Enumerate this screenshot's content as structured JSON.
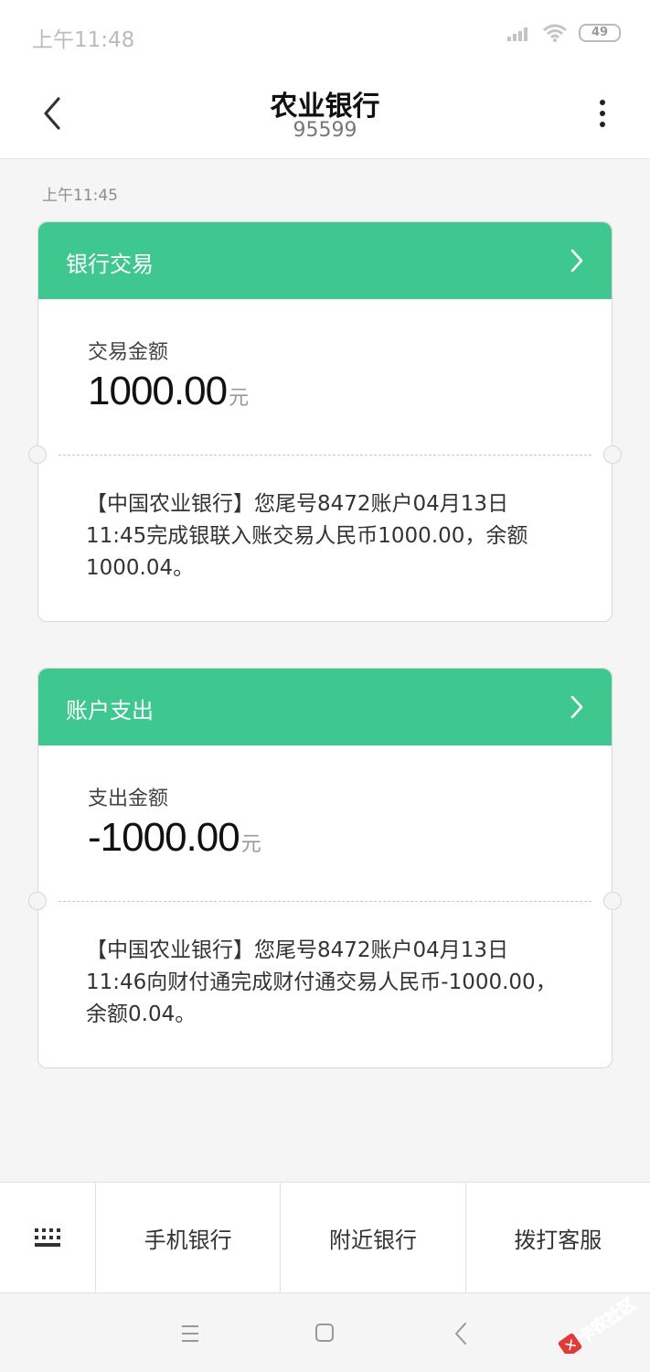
{
  "status_bar": {
    "time": "上午11:48",
    "battery": "49"
  },
  "header": {
    "title": "农业银行",
    "number": "95599"
  },
  "message_time": "上午11:45",
  "cards": [
    {
      "header": "银行交易",
      "amount_label": "交易金额",
      "amount": "1000.00",
      "unit": "元",
      "text": "【中国农业银行】您尾号8472账户04月13日11:45完成银联入账交易人民币1000.00，余额1000.04。"
    },
    {
      "header": "账户支出",
      "amount_label": "支出金额",
      "amount": "-1000.00",
      "unit": "元",
      "text": "【中国农业银行】您尾号8472账户04月13日11:46向财付通完成财付通交易人民币-1000.00，余额0.04。"
    }
  ],
  "bottom_menu": [
    "手机银行",
    "附近银行",
    "拨打客服"
  ],
  "watermark": "卡农社区",
  "colors": {
    "accent": "#3ec78e",
    "background": "#f5f5f5"
  },
  "icons": [
    "back-arrow-icon",
    "more-vert-icon",
    "chevron-right-icon",
    "keyboard-icon",
    "menu-nav-icon",
    "home-nav-icon",
    "back-nav-icon",
    "signal-icon",
    "wifi-icon"
  ]
}
